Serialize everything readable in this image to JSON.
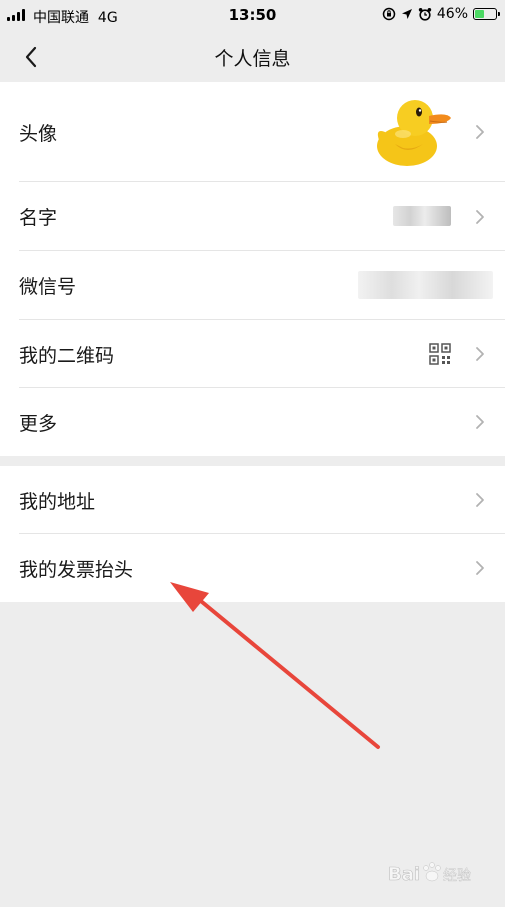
{
  "status_bar": {
    "carrier": "中国联通",
    "network": "4G",
    "time": "13:50",
    "battery": "46%",
    "battery_level": 0.46
  },
  "nav": {
    "title": "个人信息"
  },
  "rows": [
    {
      "label": "头像"
    },
    {
      "label": "名字"
    },
    {
      "label": "微信号"
    },
    {
      "label": "我的二维码"
    },
    {
      "label": "更多"
    }
  ],
  "rows2": [
    {
      "label": "我的地址"
    },
    {
      "label": "我的发票抬头"
    }
  ],
  "icons": {
    "back": "chevron-left-icon",
    "chevron": "chevron-right-icon",
    "qr": "qr-code-icon",
    "avatar": "duck-avatar"
  },
  "watermark": "经验",
  "colors": {
    "background": "#ededed",
    "accent_arrow": "#e8463b",
    "battery": "#4cd964"
  }
}
